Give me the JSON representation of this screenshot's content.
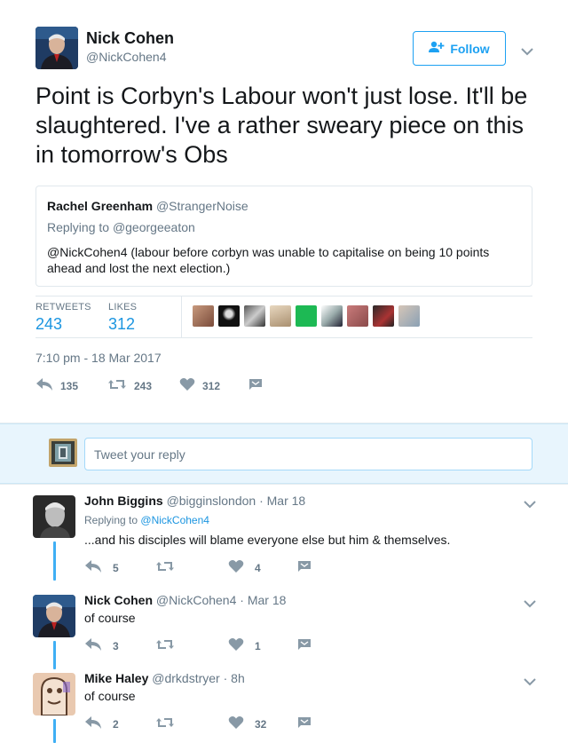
{
  "author": {
    "name": "Nick Cohen",
    "handle": "@NickCohen4",
    "follow_label": "Follow"
  },
  "tweet": {
    "text": "Point is Corbyn's Labour won't just lose. It'll be slaughtered. I've a rather sweary piece on this in tomorrow's Obs"
  },
  "quote": {
    "name": "Rachel Greenham",
    "handle": "@StrangerNoise",
    "replying_prefix": "Replying to",
    "replying_to": "@georgeeaton",
    "text": "@NickCohen4 (labour before corbyn was unable to capitalise on being 10 points ahead and lost the next election.)"
  },
  "stats": {
    "retweets_label": "RETWEETS",
    "retweets": "243",
    "likes_label": "LIKES",
    "likes": "312"
  },
  "timestamp": "7:10 pm - 18 Mar 2017",
  "actions": {
    "replies": "135",
    "retweets": "243",
    "likes": "312"
  },
  "reply_box": {
    "placeholder": "Tweet your reply"
  },
  "replies": [
    {
      "name": "John Biggins",
      "handle": "@bigginslondon",
      "time": "Mar 18",
      "replying_prefix": "Replying to",
      "replying_to": "@NickCohen4",
      "text": "...and his disciples will blame everyone else but him & themselves.",
      "reply_count": "5",
      "retweet_count": "",
      "like_count": "4"
    },
    {
      "name": "Nick Cohen",
      "handle": "@NickCohen4",
      "time": "Mar 18",
      "text": "of course",
      "reply_count": "3",
      "retweet_count": "",
      "like_count": "1"
    },
    {
      "name": "Mike Haley",
      "handle": "@drkdstryer",
      "time": "8h",
      "text": "of course",
      "reply_count": "2",
      "retweet_count": "",
      "like_count": "32"
    }
  ],
  "colors": {
    "accent": "#1da1f2",
    "link": "#1b95e0",
    "muted": "#657786"
  }
}
